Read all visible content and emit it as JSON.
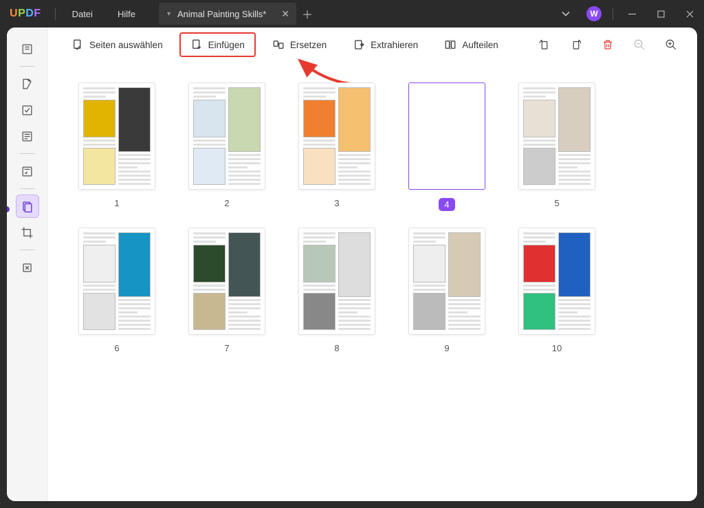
{
  "app": {
    "logo": "UPDF"
  },
  "titlebar": {
    "menu": {
      "file": "Datei",
      "help": "Hilfe"
    },
    "tab": {
      "title": "Animal Painting Skills*"
    },
    "avatar_initial": "W"
  },
  "toolbar": {
    "select_pages": "Seiten auswählen",
    "insert": "Einfügen",
    "replace": "Ersetzen",
    "extract": "Extrahieren",
    "split": "Aufteilen"
  },
  "pages": [
    {
      "n": "1",
      "selected": false
    },
    {
      "n": "2",
      "selected": false
    },
    {
      "n": "3",
      "selected": false
    },
    {
      "n": "4",
      "selected": true,
      "blank": true
    },
    {
      "n": "5",
      "selected": false
    },
    {
      "n": "6",
      "selected": false
    },
    {
      "n": "7",
      "selected": false
    },
    {
      "n": "8",
      "selected": false
    },
    {
      "n": "9",
      "selected": false
    },
    {
      "n": "10",
      "selected": false
    }
  ],
  "colors": {
    "accent": "#8a4af3",
    "callout": "#e63a2f"
  }
}
